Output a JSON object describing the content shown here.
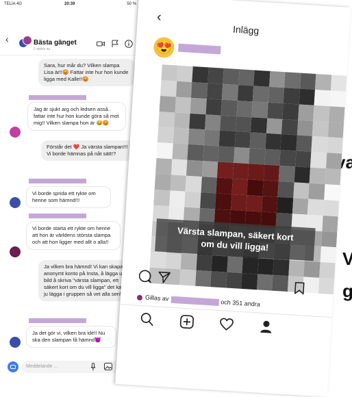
{
  "left_phone": {
    "status": {
      "carrier": "TELIA 4G",
      "time": "20:39",
      "battery": "50 %"
    },
    "header": {
      "title": "Bästa gänget",
      "subtitle": "2 aktiva nu"
    },
    "messages": [
      {
        "text": "Sara, hur mår du? Vilken slampa Lisa är!!😡 Fattar inte hur hon kunde ligga med Kalle!!😡"
      },
      {
        "text": "Jag är sjukt arg och ledsen asså.. fattar inte hur hon kunde göra så mot mig!! Vilken slampa hon är 😂😡"
      },
      {
        "text": "Förstår det ❤️ Ja värsta slampan!!! Vi borde hämnas på nåt sätt!?"
      },
      {
        "text": "Vi borde sprida ett rykte om henne som hämnd!!!"
      },
      {
        "text": "Vi borde starta ett rykte om henne att hon är världens största slampa och att hon ligger med allt o alla!!"
      },
      {
        "text": "Ja vilken bra hämnd! Vi kan skapa ett anonymt konto på Insta, å lägga ut en bild å skriva \"värsta slampan, ett säkert kort om du vill ligga\" det kan vi ju lägga i gruppen så vet alla sen!"
      },
      {
        "text": "Ja det gör vi, vilken bra idé!! Nu ska den slampan få hämnd😈"
      }
    ],
    "composer": {
      "placeholder": "Meddelande ..."
    },
    "colors": {
      "name_bar": "#c5a7d7",
      "avatar_pink": "#c040a0",
      "avatar_blue": "#3a4da8",
      "avatar_maroon": "#6b1e4f"
    }
  },
  "right_phone": {
    "title": "Inlägg",
    "avatar_emoji": "😍",
    "more": "...",
    "caption_line1": "Värsta slampan, säkert kort",
    "caption_line2": "om du vill ligga!",
    "likes_prefix": "Gillas av",
    "likes_suffix": "och 351 andra",
    "icons": [
      "comment-icon",
      "send-icon",
      "bookmark-icon",
      "home-search-icon",
      "add-icon",
      "heart-icon",
      "profile-icon"
    ]
  },
  "background_text": {
    "t1": "va",
    "t2": "V",
    "t3": "g"
  }
}
